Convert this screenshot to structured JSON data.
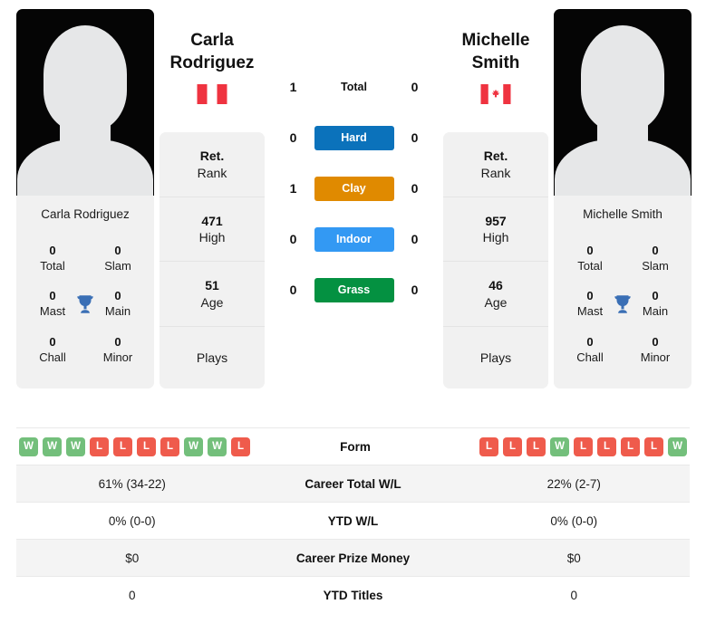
{
  "players": [
    {
      "name": "Carla Rodriguez",
      "name_line1": "Carla",
      "name_line2": "Rodriguez",
      "country": "Peru",
      "flag_icon": "flag-peru-icon",
      "avatar_icon": "avatar-placeholder-icon",
      "titles": {
        "total_value": "0",
        "total_label": "Total",
        "slam_value": "0",
        "slam_label": "Slam",
        "mast_value": "0",
        "mast_label": "Mast",
        "main_value": "0",
        "main_label": "Main",
        "chall_value": "0",
        "chall_label": "Chall",
        "minor_value": "0",
        "minor_label": "Minor",
        "trophy_icon": "trophy-icon"
      },
      "ranks": [
        {
          "value": "Ret.",
          "label": "Rank"
        },
        {
          "value": "471",
          "label": "High"
        },
        {
          "value": "51",
          "label": "Age"
        },
        {
          "value": "",
          "label": "Plays"
        }
      ],
      "form": [
        "W",
        "W",
        "W",
        "L",
        "L",
        "L",
        "L",
        "W",
        "W",
        "L"
      ],
      "career_total_wl": "61% (34-22)",
      "ytd_wl": "0% (0-0)",
      "career_prize_money": "$0",
      "ytd_titles": "0"
    },
    {
      "name": "Michelle Smith",
      "name_line1": "Michelle",
      "name_line2": "Smith",
      "country": "Canada",
      "flag_icon": "flag-canada-icon",
      "avatar_icon": "avatar-placeholder-icon",
      "titles": {
        "total_value": "0",
        "total_label": "Total",
        "slam_value": "0",
        "slam_label": "Slam",
        "mast_value": "0",
        "mast_label": "Mast",
        "main_value": "0",
        "main_label": "Main",
        "chall_value": "0",
        "chall_label": "Chall",
        "minor_value": "0",
        "minor_label": "Minor",
        "trophy_icon": "trophy-icon"
      },
      "ranks": [
        {
          "value": "Ret.",
          "label": "Rank"
        },
        {
          "value": "957",
          "label": "High"
        },
        {
          "value": "46",
          "label": "Age"
        },
        {
          "value": "",
          "label": "Plays"
        }
      ],
      "form": [
        "L",
        "L",
        "L",
        "W",
        "L",
        "L",
        "L",
        "L",
        "W"
      ],
      "career_total_wl": "22% (2-7)",
      "ytd_wl": "0% (0-0)",
      "career_prize_money": "$0",
      "ytd_titles": "0"
    }
  ],
  "head_to_head": [
    {
      "key": "total",
      "label": "Total",
      "left": "1",
      "right": "0",
      "color": "",
      "is_badge": false
    },
    {
      "key": "hard",
      "label": "Hard",
      "left": "0",
      "right": "0",
      "color": "#0b72bb",
      "is_badge": true
    },
    {
      "key": "clay",
      "label": "Clay",
      "left": "1",
      "right": "0",
      "color": "#e08a00",
      "is_badge": true
    },
    {
      "key": "indoor",
      "label": "Indoor",
      "left": "0",
      "right": "0",
      "color": "#3399f3",
      "is_badge": true
    },
    {
      "key": "grass",
      "label": "Grass",
      "left": "0",
      "right": "0",
      "color": "#049141",
      "is_badge": true
    }
  ],
  "stats_rows": [
    {
      "key": "form",
      "label": "Form"
    },
    {
      "key": "career_total_wl",
      "label": "Career Total W/L"
    },
    {
      "key": "ytd_wl",
      "label": "YTD W/L"
    },
    {
      "key": "career_prize_money",
      "label": "Career Prize Money"
    },
    {
      "key": "ytd_titles",
      "label": "YTD Titles"
    }
  ],
  "colors": {
    "win_badge": "#73bf7b",
    "loss_badge": "#ef5b4c",
    "card_bg": "#f1f1f1",
    "row_alt_bg": "#f4f4f4",
    "trophy": "#3a6fb5"
  }
}
